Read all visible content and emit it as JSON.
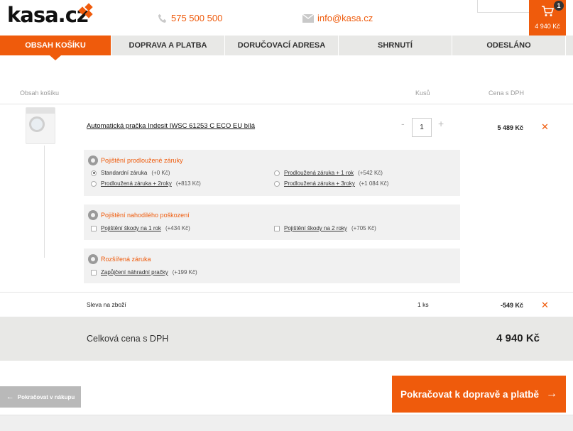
{
  "header": {
    "logo_text": "kasa.cz",
    "phone": "575 500 500",
    "email": "info@kasa.cz",
    "cart_count": "1",
    "cart_total": "4 940 Kč"
  },
  "steps": [
    {
      "label": "OBSAH KOŠÍKU"
    },
    {
      "label": "DOPRAVA A PLATBA"
    },
    {
      "label": "DORUČOVACÍ ADRESA"
    },
    {
      "label": "SHRNUTÍ"
    },
    {
      "label": "ODESLÁNO"
    }
  ],
  "table": {
    "col_content": "Obsah košíku",
    "col_qty": "Kusů",
    "col_price": "Cena s DPH"
  },
  "product": {
    "name": "Automatická pračka Indesit IWSC 61253 C ECO EU bílá",
    "qty_minus": "-",
    "qty": "1",
    "qty_plus": "+",
    "price": "5 489 Kč",
    "remove": "✕"
  },
  "options": {
    "warranty": {
      "title": "Pojištění prodloužené záruky",
      "items": [
        {
          "label": "Standardní záruka",
          "extra": "(+0 Kč)"
        },
        {
          "label": "Prodloužená záruka + 1 rok",
          "extra": "(+542 Kč)"
        },
        {
          "label": "Prodloužená záruka + 2roky",
          "extra": "(+813 Kč)"
        },
        {
          "label": "Prodloužená záruka + 3roky",
          "extra": "(+1 084 Kč)"
        }
      ]
    },
    "accident": {
      "title": "Pojištění nahodilého poškození",
      "items": [
        {
          "label": "Pojištění škody na 1 rok",
          "extra": "(+434 Kč)"
        },
        {
          "label": "Pojištění škody na 2 roky",
          "extra": "(+705 Kč)"
        }
      ]
    },
    "extended": {
      "title": "Rozšířená záruka",
      "items": [
        {
          "label": "Zapůjčení náhradní pračky",
          "extra": "(+199 Kč)"
        }
      ]
    }
  },
  "discount": {
    "name": "Sleva na zboží",
    "qty": "1 ks",
    "price": "-549 Kč",
    "remove": "✕"
  },
  "total": {
    "label": "Celková cena s DPH",
    "value": "4 940 Kč"
  },
  "footer": {
    "back_label": "Pokračovat v nákupu",
    "next_label": "Pokračovat k dopravě a platbě"
  }
}
